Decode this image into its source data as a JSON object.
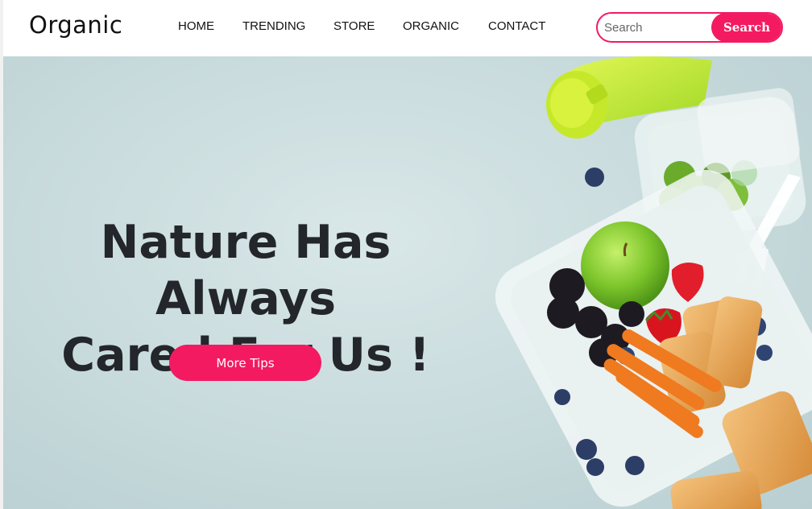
{
  "header": {
    "logo": "Organic",
    "nav": [
      {
        "label": "HOME",
        "name": "nav-item-home"
      },
      {
        "label": "TRENDING",
        "name": "nav-item-trending"
      },
      {
        "label": "STORE",
        "name": "nav-item-store"
      },
      {
        "label": "ORGANIC",
        "name": "nav-item-organic"
      },
      {
        "label": "CONTACT",
        "name": "nav-item-contact"
      }
    ],
    "search": {
      "placeholder": "Search",
      "button_label": "Search"
    }
  },
  "hero": {
    "title_line1": "Nature Has Always",
    "title_line2": "Cared For Us !",
    "cta_label": "More Tips",
    "image": "lunchbox-food-illustration"
  },
  "colors": {
    "accent": "#f31a61",
    "hero_bg": "#c7dadc",
    "title": "#23262b"
  }
}
